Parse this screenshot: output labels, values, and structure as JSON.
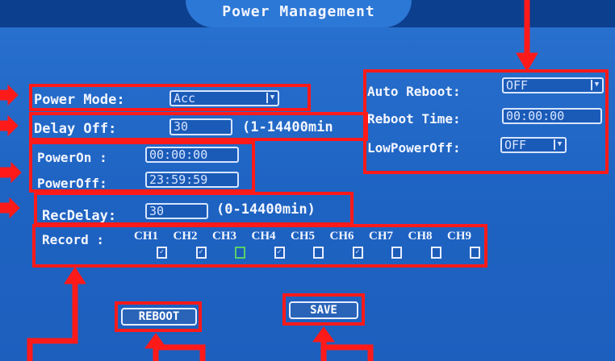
{
  "title": "Power Management",
  "power_mode": {
    "label": "Power Mode:",
    "value": "Acc"
  },
  "delay_off": {
    "label": "Delay  Off:",
    "value": "30",
    "range": "(1-14400min"
  },
  "power_on": {
    "label": "PowerOn  :",
    "value": "00:00:00"
  },
  "power_off": {
    "label": "PowerOff:",
    "value": "23:59:59"
  },
  "rec_delay": {
    "label": "RecDelay:",
    "value": "30",
    "range": "(0-14400min)"
  },
  "record": {
    "label": "Record  :",
    "channels": [
      {
        "name": "CH1",
        "checked": true
      },
      {
        "name": "CH2",
        "checked": true
      },
      {
        "name": "CH3",
        "checked": false
      },
      {
        "name": "CH4",
        "checked": true
      },
      {
        "name": "CH5",
        "checked": false
      },
      {
        "name": "CH6",
        "checked": true
      },
      {
        "name": "CH7",
        "checked": false
      },
      {
        "name": "CH8",
        "checked": false
      },
      {
        "name": "CH9",
        "checked": false
      }
    ]
  },
  "auto_reboot": {
    "label": "Auto Reboot:",
    "value": "OFF"
  },
  "reboot_time": {
    "label": "Reboot Time:",
    "value": "00:00:00"
  },
  "low_power_off": {
    "label": "LowPowerOff:",
    "value": "OFF"
  },
  "buttons": {
    "reboot": "REBOOT",
    "save": "SAVE"
  },
  "icons": {
    "dropdown": "dropdown-arrow-icon",
    "checkbox": "checkbox-icon",
    "annotation": "red-arrow"
  },
  "colors": {
    "background": "#1f66c4",
    "highlight": "#ff1a1a",
    "text": "#f3f6ff"
  }
}
